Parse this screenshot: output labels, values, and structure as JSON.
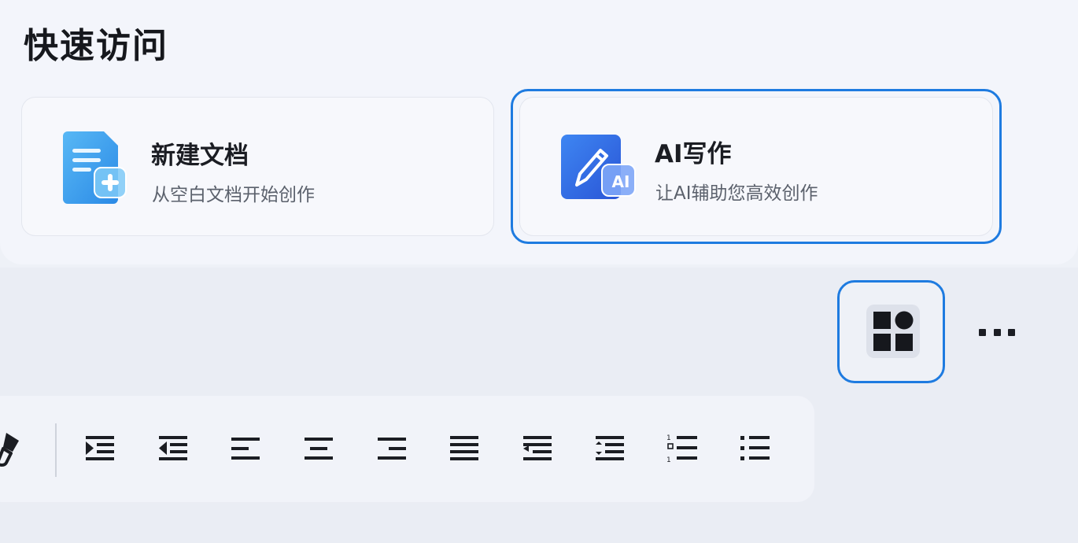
{
  "section": {
    "title": "快速访问"
  },
  "cards": {
    "new_doc": {
      "title": "新建文档",
      "subtitle": "从空白文档开始创作",
      "icon": "new-document-icon"
    },
    "ai_write": {
      "title": "AI写作",
      "subtitle": "让AI辅助您高效创作",
      "icon": "ai-pen-icon",
      "badge": "AI"
    }
  },
  "toolbar": {
    "apps_icon": "apps-grid-icon",
    "more_icon": "more-dots-icon",
    "format_tools": [
      "format-painter-icon",
      "increase-indent-icon",
      "decrease-indent-icon",
      "align-left-icon",
      "align-center-icon",
      "align-right-icon",
      "justify-icon",
      "distributed-align-icon",
      "line-spacing-icon",
      "numbered-list-icon",
      "bulleted-list-icon"
    ]
  },
  "colors": {
    "accent": "#1e7be0",
    "doc_icon": "#3aa0ec",
    "ai_icon": "#2f6ee6",
    "icon_dark": "#1b1d23"
  }
}
